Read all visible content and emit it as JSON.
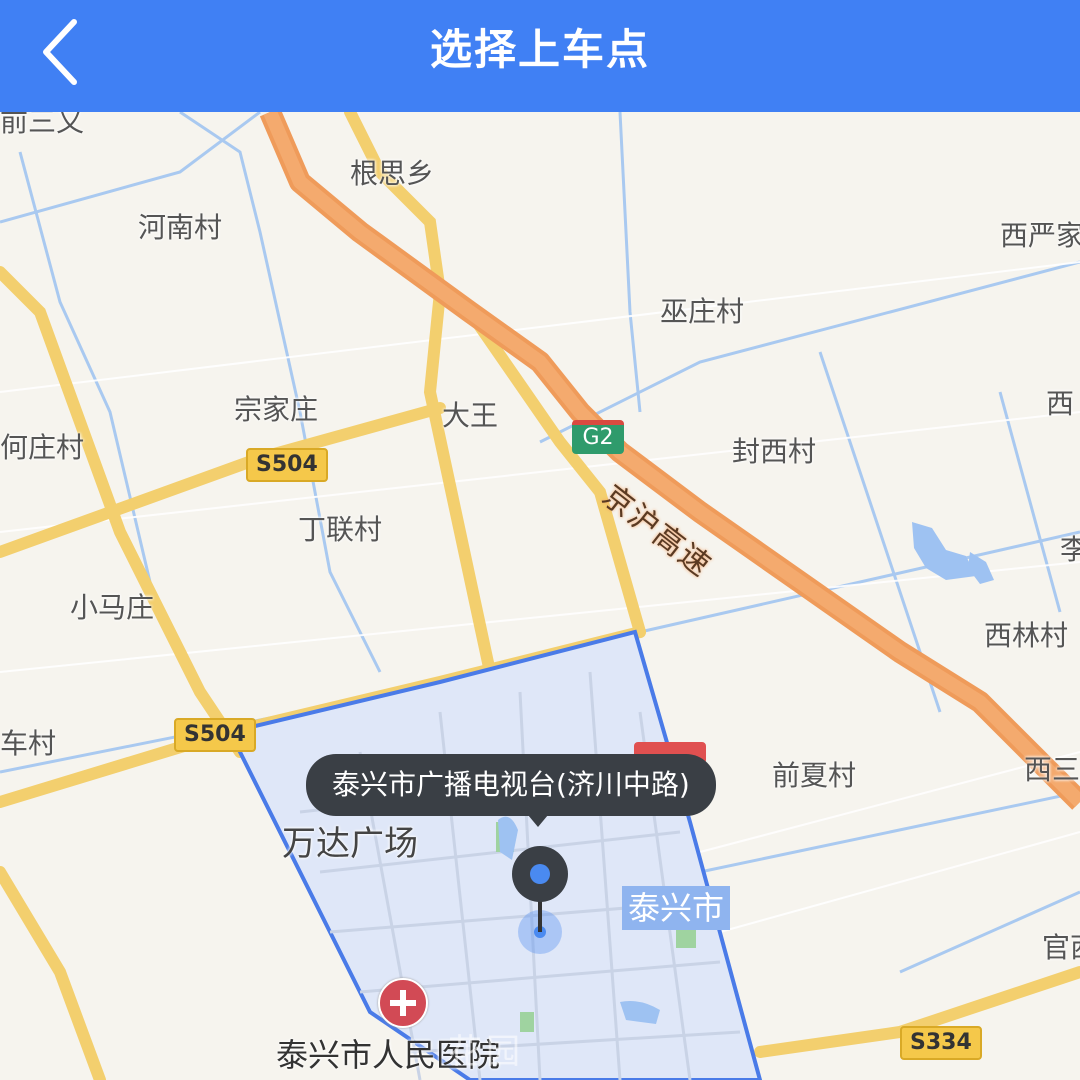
{
  "header": {
    "title": "选择上车点",
    "back_icon": "chevron-left-icon"
  },
  "colors": {
    "header": "#4080f4",
    "expressway": "#f0a060",
    "provincial": "#f3cf6e",
    "zone_border": "#4a7be8",
    "zone_fill": "#dfe7f8"
  },
  "map": {
    "places": [
      "前三又",
      "根思乡",
      "河南村",
      "西严家",
      "巫庄村",
      "宗家庄",
      "大王",
      "西",
      "何庄村",
      "封西村",
      "丁联村",
      "李",
      "小马庄",
      "西林村",
      "车村",
      "前夏村",
      "西三",
      "官西"
    ],
    "shields": {
      "s504_a": "S504",
      "s504_b": "S504",
      "g2": "G2",
      "s334": "S334"
    },
    "expressway_name": "京沪高速",
    "landmark": "万达广场",
    "city_label": "泰兴市",
    "hospital": "泰兴市人民医院",
    "watermark": "花园",
    "pickup_tooltip": "泰兴市广播电视台(济川中路)"
  }
}
